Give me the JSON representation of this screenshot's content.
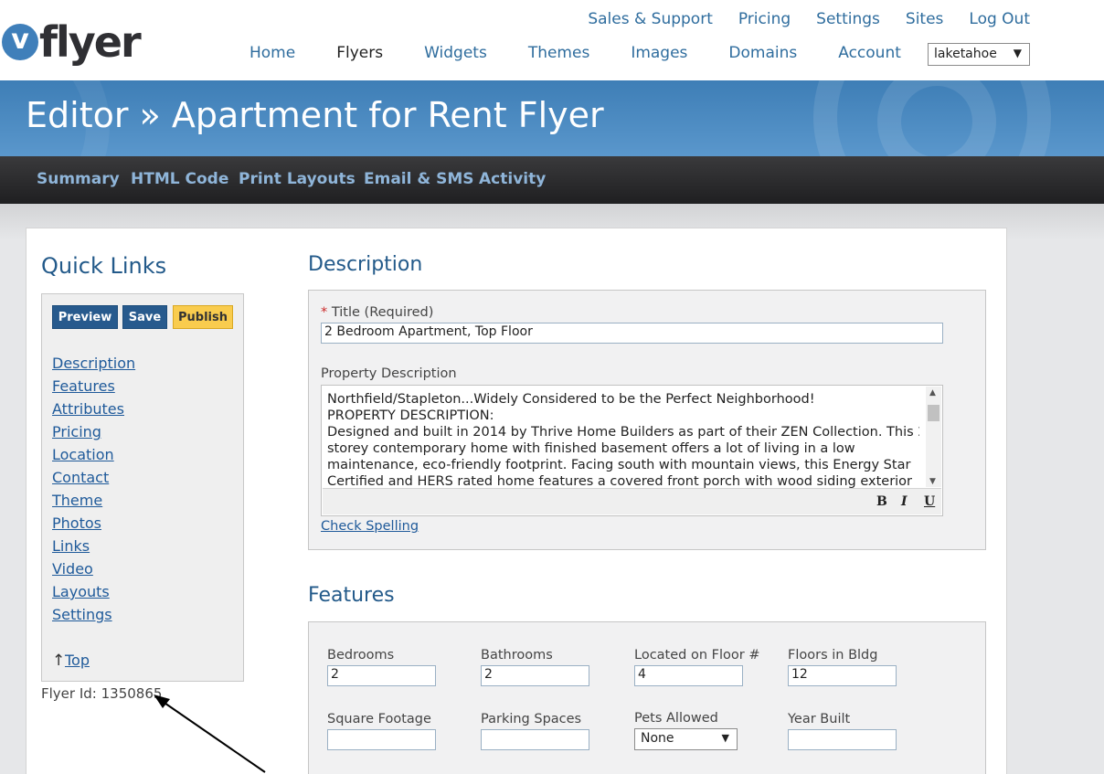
{
  "header": {
    "logo_letter": "v",
    "logo_text": "flyer",
    "util_nav": [
      "Sales & Support",
      "Pricing",
      "Settings",
      "Sites",
      "Log Out"
    ],
    "main_nav": [
      "Home",
      "Flyers",
      "Widgets",
      "Themes",
      "Images",
      "Domains",
      "Account"
    ],
    "active_nav": "Flyers",
    "account_select": "laketahoe"
  },
  "banner": {
    "title": "Editor » Apartment for Rent Flyer"
  },
  "subnav": [
    "Summary",
    "HTML Code",
    "Print Layouts",
    "Email & SMS",
    "Activity"
  ],
  "quick_links": {
    "title": "Quick Links",
    "buttons": {
      "preview": "Preview",
      "save": "Save",
      "publish": "Publish"
    },
    "links": [
      "Description",
      "Features",
      "Attributes",
      "Pricing",
      "Location",
      "Contact",
      "Theme",
      "Photos",
      "Links",
      "Video",
      "Layouts",
      "Settings"
    ],
    "top_arrow": "↑",
    "top_link": "Top",
    "flyer_id": "Flyer Id: 1350865"
  },
  "description": {
    "heading": "Description",
    "title_required_mark": "*",
    "title_label": "Title (Required)",
    "title_value": "2 Bedroom Apartment, Top Floor",
    "property_label": "Property Description",
    "property_lines": [
      "Northfield/Stapleton...Widely Considered to be the Perfect Neighborhood!",
      "PROPERTY DESCRIPTION:",
      "Designed and built in 2014 by Thrive Home Builders as part of their ZEN Collection. This 2-",
      "storey contemporary home with finished basement offers a lot of living in a low",
      "maintenance, eco-friendly footprint. Facing south with mountain views, this Energy Star",
      "Certified and HERS rated home features a covered front porch with wood siding exterior"
    ],
    "toolbar": {
      "bold": "B",
      "italic": "I",
      "underline": "U"
    },
    "check_spelling": "Check Spelling"
  },
  "features": {
    "heading": "Features",
    "fields": [
      {
        "label": "Bedrooms",
        "value": "2"
      },
      {
        "label": "Bathrooms",
        "value": "2"
      },
      {
        "label": "Located on Floor #",
        "value": "4"
      },
      {
        "label": "Floors in Bldg",
        "value": "12"
      },
      {
        "label": "Square Footage",
        "value": ""
      },
      {
        "label": "Parking Spaces",
        "value": ""
      },
      {
        "label": "Pets Allowed",
        "value": "None"
      },
      {
        "label": "Year Built",
        "value": ""
      }
    ]
  },
  "colors": {
    "link_blue": "#2f6d9e",
    "heading_blue": "#235a8a",
    "button_blue": "#275a8d",
    "publish_yellow": "#f9cc4e",
    "banner_blue": "#4a89c1",
    "subnav_link": "#8fb5d9"
  }
}
